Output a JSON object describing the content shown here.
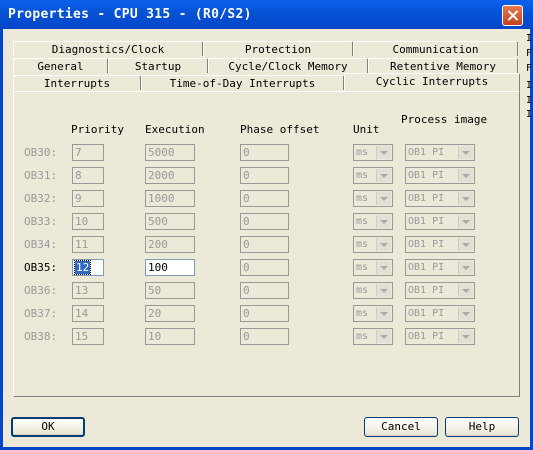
{
  "window": {
    "title": "Properties - CPU 315 - (R0/S2)"
  },
  "tabs": {
    "row1": [
      "Diagnostics/Clock",
      "Protection",
      "Communication"
    ],
    "row2": [
      "General",
      "Startup",
      "Cycle/Clock Memory",
      "Retentive Memory"
    ],
    "row3": [
      "Interrupts",
      "Time-of-Day Interrupts",
      "Cyclic Interrupts"
    ],
    "active": "Cyclic Interrupts"
  },
  "columns": {
    "priority": "Priority",
    "execution": "Execution",
    "phase": "Phase offset",
    "unit": "Unit",
    "process_image": "Process image"
  },
  "rows": [
    {
      "ob": "OB30:",
      "priority": "7",
      "execution": "5000",
      "phase": "0",
      "unit": "ms",
      "image": "OB1 PI"
    },
    {
      "ob": "OB31:",
      "priority": "8",
      "execution": "2000",
      "phase": "0",
      "unit": "ms",
      "image": "OB1 PI"
    },
    {
      "ob": "OB32:",
      "priority": "9",
      "execution": "1000",
      "phase": "0",
      "unit": "ms",
      "image": "OB1 PI"
    },
    {
      "ob": "OB33:",
      "priority": "10",
      "execution": "500",
      "phase": "0",
      "unit": "ms",
      "image": "OB1 PI"
    },
    {
      "ob": "OB34:",
      "priority": "11",
      "execution": "200",
      "phase": "0",
      "unit": "ms",
      "image": "OB1 PI"
    },
    {
      "ob": "OB35:",
      "priority": "12",
      "execution": "100",
      "phase": "0",
      "unit": "ms",
      "image": "OB1 PI"
    },
    {
      "ob": "OB36:",
      "priority": "13",
      "execution": "50",
      "phase": "0",
      "unit": "ms",
      "image": "OB1 PI"
    },
    {
      "ob": "OB37:",
      "priority": "14",
      "execution": "20",
      "phase": "0",
      "unit": "ms",
      "image": "OB1 PI"
    },
    {
      "ob": "OB38:",
      "priority": "15",
      "execution": "10",
      "phase": "0",
      "unit": "ms",
      "image": "OB1 PI"
    }
  ],
  "buttons": {
    "ok": "OK",
    "cancel": "Cancel",
    "help": "Help"
  },
  "background_window": {
    "letters": [
      "I",
      "F",
      "F",
      "I",
      "I",
      "I"
    ]
  },
  "icons": {
    "close": "close-icon",
    "dropdown": "chevron-down-icon"
  },
  "colors": {
    "titlebar": "#0346c8",
    "selection": "#316ac5",
    "dialog": "#ece9d8"
  }
}
